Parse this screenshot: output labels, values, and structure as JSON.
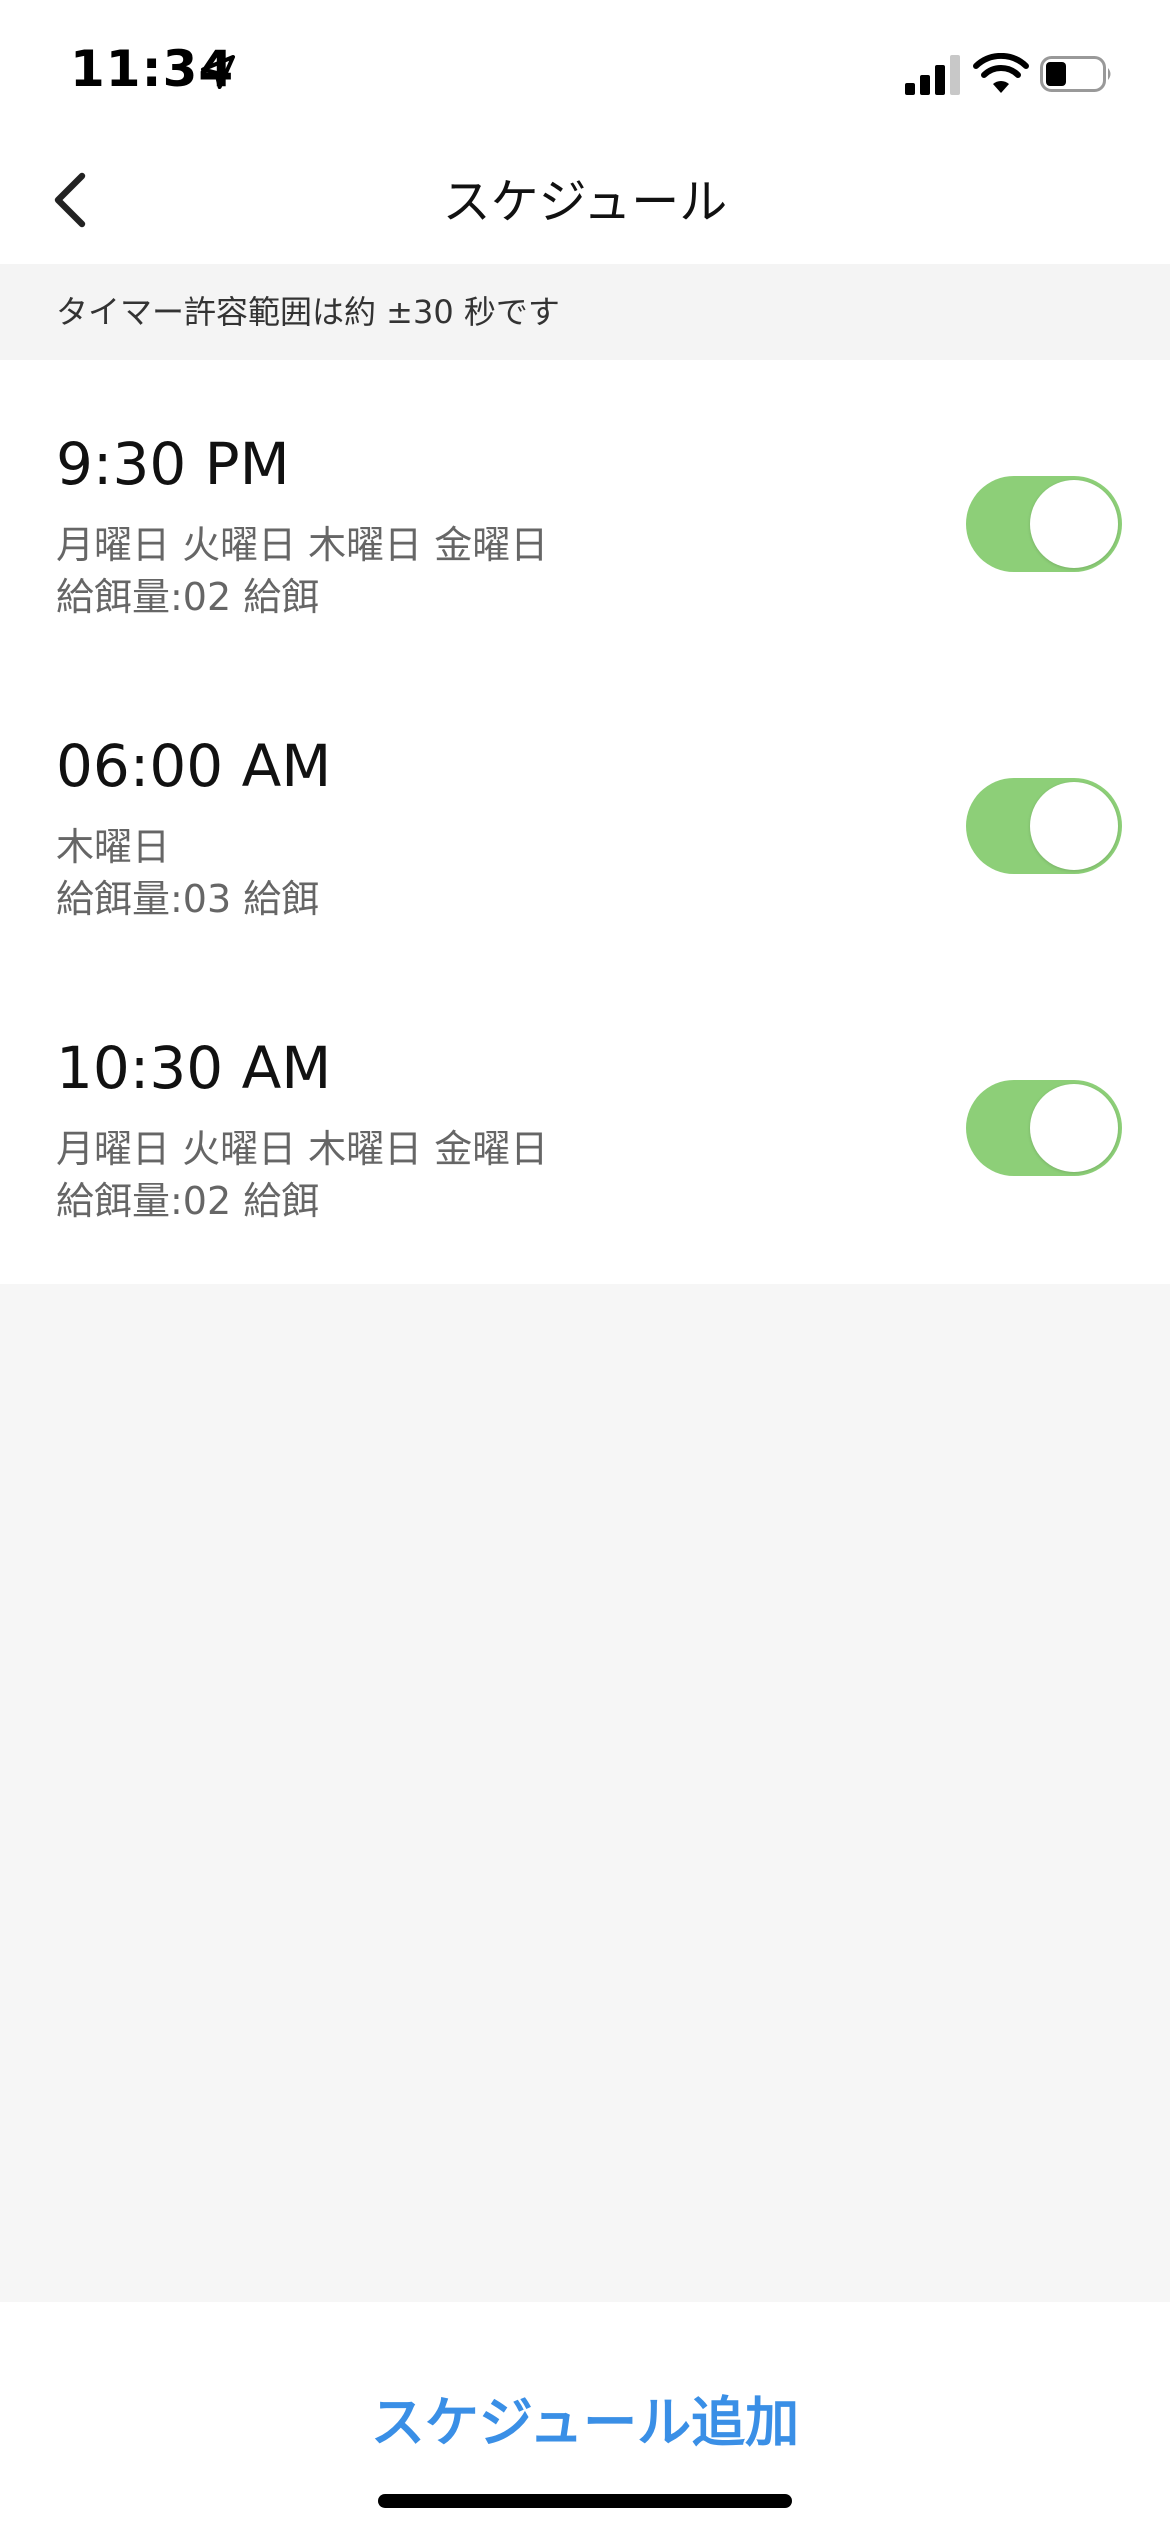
{
  "status_bar": {
    "time": "11:34",
    "location_icon": "location-arrow-icon",
    "signal_icon": "cellular-signal-icon",
    "wifi_icon": "wifi-icon",
    "battery_icon": "battery-icon",
    "battery_level": 0.4
  },
  "nav": {
    "back_icon": "chevron-left-icon",
    "title": "スケジュール"
  },
  "notice": {
    "text": "タイマー許容範囲は約 ±30 秒です"
  },
  "schedules": [
    {
      "time": "9:30 PM",
      "days": "月曜日 火曜日 木曜日 金曜日",
      "amount": "給餌量:02 給餌",
      "enabled": true
    },
    {
      "time": "06:00 AM",
      "days": "木曜日",
      "amount": "給餌量:03 給餌",
      "enabled": true
    },
    {
      "time": "10:30 AM",
      "days": "月曜日 火曜日 木曜日 金曜日",
      "amount": "給餌量:02 給餌",
      "enabled": true
    }
  ],
  "bottom": {
    "add_label": "スケジュール追加"
  },
  "colors": {
    "accent": "#3a8fe6",
    "toggle_on": "#8dcf78",
    "background_gray": "#f6f6f6"
  }
}
